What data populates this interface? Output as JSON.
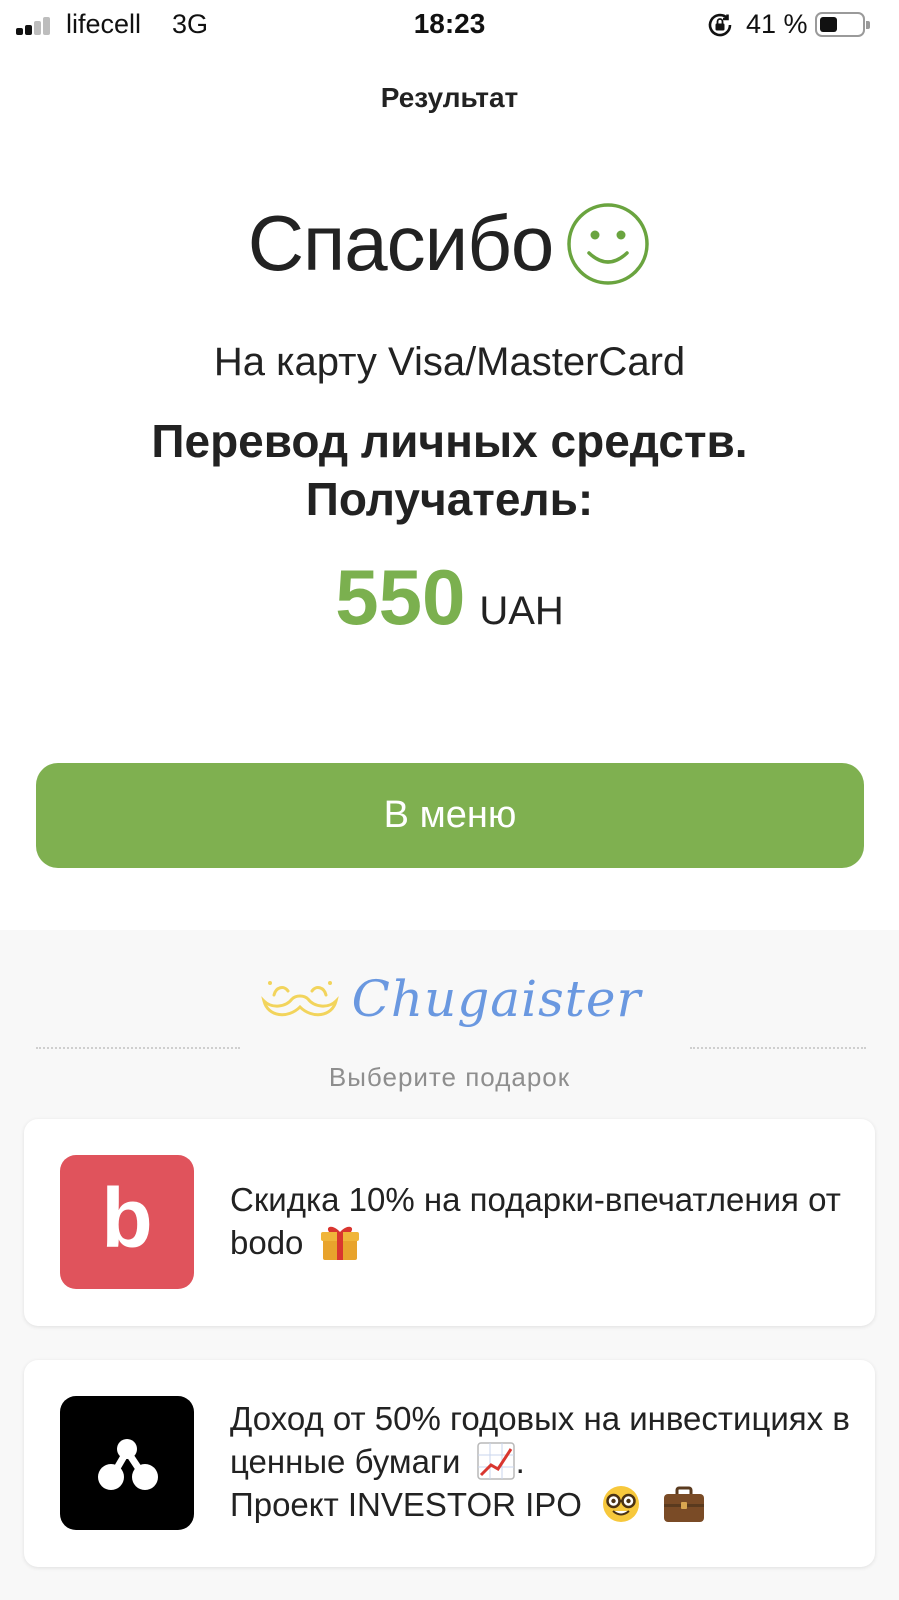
{
  "status_bar": {
    "carrier": "lifecell",
    "network": "3G",
    "time": "18:23",
    "battery_percent": "41 %",
    "battery_level": 0.41
  },
  "header": {
    "title": "Результат"
  },
  "result": {
    "thanks": "Спасибо",
    "card_type": "На карту Visa/MasterCard",
    "purpose": "Перевод личных средств. Получатель:",
    "amount": "550",
    "currency": "UAH"
  },
  "actions": {
    "menu_button_label": "В меню"
  },
  "gifts": {
    "brand": "Chugaister",
    "choose_label": "Выберите подарок",
    "offers": [
      {
        "logo_letter": "b",
        "text": "Скидка 10% на подарки-впечатления от bodo"
      },
      {
        "text_part1": "Доход от 50% годовых на инвестициях в ценные бумаги",
        "text_part2": ".",
        "text_part3": "Проект INVESTOR IPO"
      }
    ]
  },
  "colors": {
    "accent_green": "#7fb050",
    "amount_green": "#7bb04f",
    "bodo_red": "#e0535c",
    "brand_blue": "#6a98e0",
    "mustache_yellow": "#f2d45c"
  },
  "icons": [
    "signal-icon",
    "rotation-lock-icon",
    "battery-icon",
    "smile-icon",
    "mustache-icon",
    "gift-icon",
    "chart-up-icon",
    "nerd-face-icon",
    "briefcase-icon",
    "investor-logo-icon"
  ]
}
